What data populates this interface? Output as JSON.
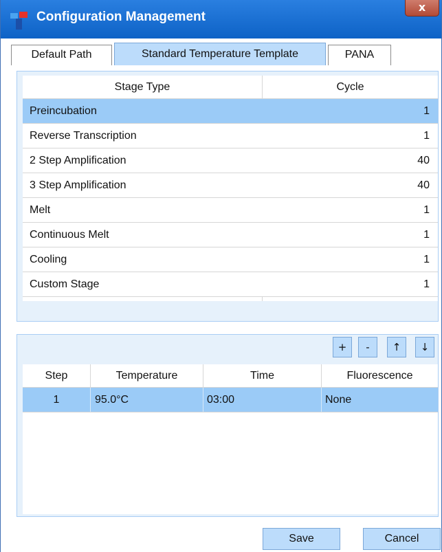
{
  "window": {
    "title": "Configuration Management",
    "close_label": "x",
    "accent": "#1a71d8"
  },
  "tabs": [
    {
      "label": "Default Path",
      "active": false
    },
    {
      "label": "Standard Temperature Template",
      "active": true
    },
    {
      "label": "PANA",
      "active": false
    }
  ],
  "stages": {
    "headers": {
      "type": "Stage Type",
      "cycle": "Cycle"
    },
    "rows": [
      {
        "type": "Preincubation",
        "cycle": "1",
        "selected": true
      },
      {
        "type": "Reverse Transcription",
        "cycle": "1"
      },
      {
        "type": "2 Step Amplification",
        "cycle": "40"
      },
      {
        "type": "3 Step Amplification",
        "cycle": "40"
      },
      {
        "type": "Melt",
        "cycle": "1"
      },
      {
        "type": "Continuous Melt",
        "cycle": "1"
      },
      {
        "type": "Cooling",
        "cycle": "1"
      },
      {
        "type": "Custom Stage",
        "cycle": "1"
      }
    ]
  },
  "step_toolbar": {
    "add": "+",
    "remove": "-",
    "up": "↑",
    "down": "↓"
  },
  "steps": {
    "headers": {
      "step": "Step",
      "temperature": "Temperature",
      "time": "Time",
      "fluorescence": "Fluorescence"
    },
    "rows": [
      {
        "step": "1",
        "temperature": "95.0°C",
        "time": "03:00",
        "fluorescence": "None",
        "selected": true
      }
    ]
  },
  "footer": {
    "save": "Save",
    "cancel": "Cancel"
  },
  "colors": {
    "selection": "#9bcbf7",
    "button": "#bcdcfb",
    "panel": "#e6f1fb"
  }
}
